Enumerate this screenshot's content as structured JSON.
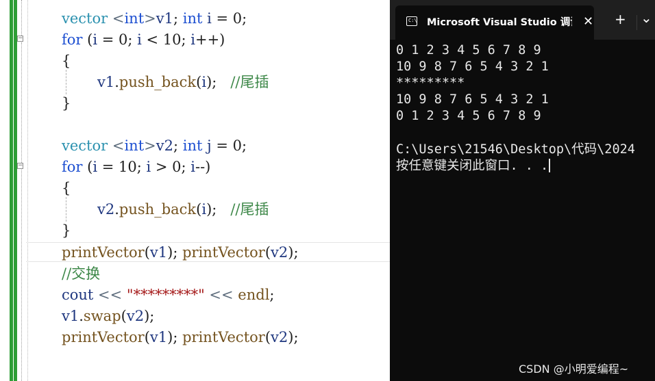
{
  "editor": {
    "lines": {
      "l1": {
        "type": "vector",
        "t1": " <",
        "int": "int",
        "t2": ">",
        "v": "v1",
        "t3": "; ",
        "kw": "int",
        "t4": " ",
        "i": "i",
        "t5": " = 0;"
      },
      "l2": {
        "kw": "for",
        "t1": " (",
        "a": "i",
        "t2": " = 0; ",
        "b": "i",
        "t3": " < 10; ",
        "c": "i",
        "t4": "++)"
      },
      "l3": "{",
      "l4": {
        "v": "v1",
        "t1": ".",
        "fn": "push_back",
        "t2": "(",
        "i": "i",
        "t3": ");   ",
        "cm": "//尾插"
      },
      "l5": "}",
      "l6": {
        "type": "vector",
        "t1": " <",
        "int": "int",
        "t2": ">",
        "v": "v2",
        "t3": "; ",
        "kw": "int",
        "t4": " ",
        "j": "j",
        "t5": " = 0;"
      },
      "l7": {
        "kw": "for",
        "t1": " (",
        "a": "i",
        "t2": " = 10; ",
        "b": "i",
        "t3": " > 0; ",
        "c": "i",
        "t4": "--)"
      },
      "l8": "{",
      "l9": {
        "v": "v2",
        "t1": ".",
        "fn": "push_back",
        "t2": "(",
        "i": "i",
        "t3": ");   ",
        "cm": "//尾插"
      },
      "l10": "}",
      "l11": {
        "f1": "printVector",
        "t1": "(",
        "a1": "v1",
        "t2": "); ",
        "f2": "printVector",
        "t3": "(",
        "a2": "v2",
        "t4": ");"
      },
      "l12": "//交换",
      "l13": {
        "cout": "cout",
        "op1": " << ",
        "str": "\"*********\"",
        "op2": " << ",
        "endl": "endl",
        "semi": ";"
      },
      "l14": {
        "v": "v1",
        "t1": ".",
        "fn": "swap",
        "t2": "(",
        "a": "v2",
        "t3": ");"
      },
      "l15": {
        "f1": "printVector",
        "t1": "(",
        "a1": "v1",
        "t2": "); ",
        "f2": "printVector",
        "t3": "(",
        "a2": "v2",
        "t4": ");"
      }
    },
    "fold_symbol": "−"
  },
  "console": {
    "tab_title": "Microsoft Visual Studio 调试控",
    "tab_icon_text": "C:\\",
    "close_symbol": "✕",
    "new_tab_symbol": "+",
    "dropdown_symbol": "⌄",
    "output": [
      "0 1 2 3 4 5 6 7 8 9",
      "10 9 8 7 6 5 4 3 2 1",
      "*********",
      "10 9 8 7 6 5 4 3 2 1",
      "0 1 2 3 4 5 6 7 8 9",
      "",
      "C:\\Users\\21546\\Desktop\\代码\\2024",
      "按任意键关闭此窗口. . ."
    ],
    "watermark": "CSDN @小明爱编程~"
  },
  "colors": {
    "keyword": "#1d4fd1",
    "type": "#2b91af",
    "function": "#74531f",
    "variable": "#1f377f",
    "comment": "#3c8747",
    "string": "#a31515",
    "console_bg": "#0c0c0c",
    "change_bar": "#2e9e36"
  },
  "icons": [
    "fold-collapse-icon",
    "terminal-icon",
    "close-icon",
    "new-tab-icon",
    "dropdown-icon"
  ]
}
